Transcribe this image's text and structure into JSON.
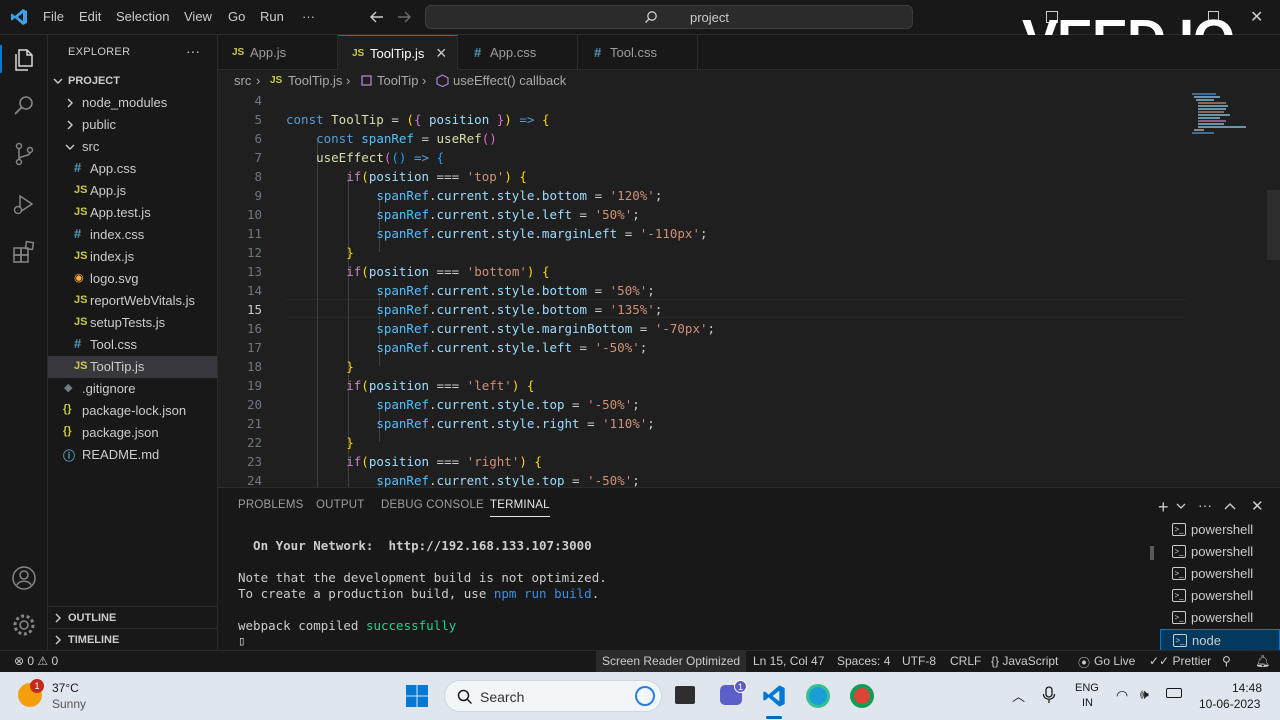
{
  "titlebar": {
    "menu": [
      "File",
      "Edit",
      "Selection",
      "View",
      "Go",
      "Run",
      "···"
    ],
    "search_text": "project"
  },
  "watermark": "VEED.IO",
  "sidebar": {
    "header": "EXPLORER",
    "more": "···",
    "project": "PROJECT",
    "items": [
      {
        "label": "node_modules",
        "icon": "chevron-right"
      },
      {
        "label": "public",
        "icon": "chevron-right"
      },
      {
        "label": "src",
        "icon": "chevron-down"
      },
      {
        "label": "App.css",
        "badge": "#"
      },
      {
        "label": "App.js",
        "badge": "JS"
      },
      {
        "label": "App.test.js",
        "badge": "JS"
      },
      {
        "label": "index.css",
        "badge": "#"
      },
      {
        "label": "index.js",
        "badge": "JS"
      },
      {
        "label": "logo.svg",
        "badge": "◉"
      },
      {
        "label": "reportWebVitals.js",
        "badge": "JS"
      },
      {
        "label": "setupTests.js",
        "badge": "JS"
      },
      {
        "label": "Tool.css",
        "badge": "#"
      },
      {
        "label": "ToolTip.js",
        "badge": "JS"
      },
      {
        "label": ".gitignore",
        "badge": "◆"
      },
      {
        "label": "package-lock.json",
        "badge": "{}"
      },
      {
        "label": "package.json",
        "badge": "{}"
      },
      {
        "label": "README.md",
        "badge": "ⓘ"
      }
    ],
    "outline": "OUTLINE",
    "timeline": "TIMELINE"
  },
  "tabs": [
    {
      "label": "App.js",
      "badge": "JS"
    },
    {
      "label": "ToolTip.js",
      "badge": "JS",
      "close": "×"
    },
    {
      "label": "App.css",
      "badge": "#"
    },
    {
      "label": "Tool.css",
      "badge": "#"
    }
  ],
  "breadcrumb": [
    "src",
    "›",
    "JS",
    "ToolTip.js",
    "›",
    "ToolTip",
    "›",
    "useEffect() callback"
  ],
  "editor": {
    "line_numbers": [
      "4",
      "5",
      "6",
      "7",
      "8",
      "9",
      "10",
      "11",
      "12",
      "13",
      "14",
      "15",
      "16",
      "17",
      "18",
      "19",
      "20",
      "21",
      "22",
      "23",
      "24"
    ],
    "current_line": "15"
  },
  "panel": {
    "tabs": [
      "PROBLEMS",
      "OUTPUT",
      "DEBUG CONSOLE",
      "TERMINAL"
    ],
    "terminal": {
      "network_label": "  On Your Network:  ",
      "network_url": "http://192.168.133.107:3000",
      "line1": "Note that the development build is not optimized.",
      "line2_a": "To create a production build, use ",
      "line2_b": "npm run build",
      "line2_c": ".",
      "compiled_a": "webpack compiled ",
      "compiled_b": "successfully",
      "prompt": "▯"
    },
    "terminals": [
      "powershell",
      "powershell",
      "powershell",
      "powershell",
      "powershell",
      "node"
    ]
  },
  "statusbar": {
    "problems": "⊗ 0 ⚠ 0",
    "screen_reader": "Screen Reader Optimized",
    "position": "Ln 15, Col 47",
    "spaces": "Spaces: 4",
    "encoding": "UTF-8",
    "eol": "CRLF",
    "language": "{} JavaScript",
    "golive": "Go Live",
    "prettier": "✓✓ Prettier"
  },
  "taskbar": {
    "weather_badge": "1",
    "temperature": "37°C",
    "weather": "Sunny",
    "search": "Search",
    "teams_badge": "1",
    "lang1": "ENG",
    "lang2": "IN",
    "time": "14:48",
    "date": "10-06-2023"
  }
}
